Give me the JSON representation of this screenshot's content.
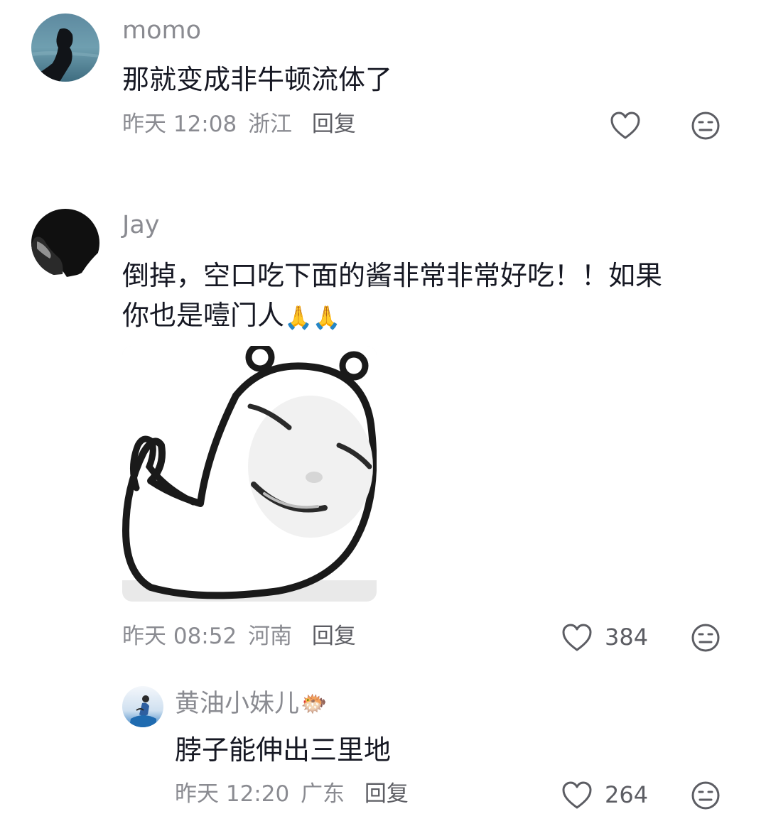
{
  "comments": [
    {
      "username": "momo",
      "text": "那就变成非牛顿流体了",
      "time": "昨天 12:08",
      "location": "浙江",
      "reply_label": "回复"
    },
    {
      "username": "Jay",
      "text_line1": "倒掉，空口吃下面的酱非常非常好吃！！如果",
      "text_line2": "你也是噎门人",
      "emoji": "🙏🙏",
      "time": "昨天 08:52",
      "location": "河南",
      "reply_label": "回复",
      "like_count": "384"
    }
  ],
  "replies": [
    {
      "username": "黄油小妹儿",
      "username_emoji": "🐡",
      "text": "脖子能伸出三里地",
      "time": "昨天 12:20",
      "location": "广东",
      "reply_label": "回复",
      "like_count": "264"
    }
  ],
  "icons": {
    "like": "heart-outline-icon",
    "dislike": "neutral-face-icon"
  },
  "colors": {
    "text_primary": "#161823",
    "text_secondary": "#8a8b91",
    "reply_link": "#5c5d63"
  }
}
